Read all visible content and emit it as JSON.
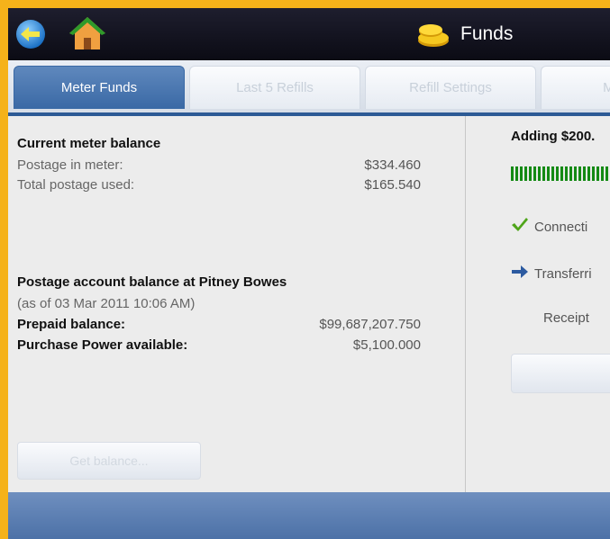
{
  "header": {
    "title": "Funds",
    "back_icon": "back-arrow-icon",
    "home_icon": "home-icon",
    "title_icon": "coins-icon"
  },
  "tabs": [
    {
      "label": "Meter Funds",
      "active": true
    },
    {
      "label": "Last 5 Refills",
      "active": false
    },
    {
      "label": "Refill Settings",
      "active": false
    },
    {
      "label": "Meter F",
      "active": false
    }
  ],
  "meter": {
    "heading": "Current meter balance",
    "postage_label": "Postage in meter:",
    "postage_value": "$334.460",
    "used_label": "Total postage used:",
    "used_value": "$165.540"
  },
  "account": {
    "heading": "Postage account balance at Pitney Bowes",
    "as_of": "(as of 03 Mar 2011   10:06 AM)",
    "prepaid_label": "Prepaid balance:",
    "prepaid_value": "$99,687,207.750",
    "power_label": "Purchase Power available:",
    "power_value": "$5,100.000"
  },
  "left_button_label": "Get balance...",
  "transfer": {
    "adding": "Adding $200.",
    "progress": 1.0,
    "step1": "Connecti",
    "step2": "Transferri",
    "receipt": "Receipt"
  },
  "colors": {
    "border": "#f5b21a",
    "accent": "#3a69a5",
    "check": "#4fa51a",
    "arrow": "#2c5aa0",
    "progress": "#148a14"
  }
}
